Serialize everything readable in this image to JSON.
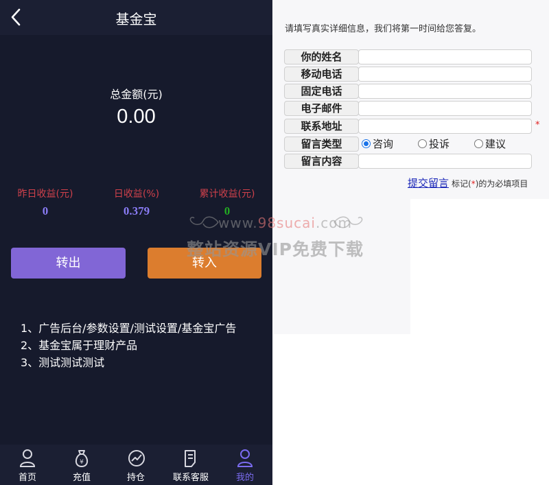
{
  "header": {
    "title": "基金宝"
  },
  "summary": {
    "total_label": "总金额(元)",
    "total_value": "0.00"
  },
  "stats": [
    {
      "label": "昨日收益(元)",
      "value": "0",
      "value_color": "#8a7cf5"
    },
    {
      "label": "日收益(%)",
      "value": "0.379",
      "value_color": "#8a7cf5"
    },
    {
      "label": "累计收益(元)",
      "value": "0",
      "value_color": "#22aa22"
    }
  ],
  "actions": {
    "transfer_out": "转出",
    "transfer_in": "转入"
  },
  "notes": [
    "1、广告后台/参数设置/测试设置/基金宝广告",
    "2、基金宝属于理财产品",
    "3、测试测试测试"
  ],
  "tabs": [
    {
      "label": "首页",
      "icon": "user-icon"
    },
    {
      "label": "充值",
      "icon": "money-bag-icon"
    },
    {
      "label": "持仓",
      "icon": "chart-icon"
    },
    {
      "label": "联系客服",
      "icon": "document-icon"
    },
    {
      "label": "我的",
      "icon": "user-icon",
      "active": true
    }
  ],
  "form": {
    "intro": "请填写真实详细信息，我们将第一时间给您答复。",
    "fields": [
      {
        "label": "你的姓名",
        "value": ""
      },
      {
        "label": "移动电话",
        "value": ""
      },
      {
        "label": "固定电话",
        "value": ""
      },
      {
        "label": "电子邮件",
        "value": ""
      },
      {
        "label": "联系地址",
        "value": ""
      }
    ],
    "required_mark": "*",
    "type_label": "留言类型",
    "type_options": [
      "咨询",
      "投诉",
      "建议"
    ],
    "type_selected": "咨询",
    "content_label": "留言内容",
    "content_value": "",
    "submit_label": "提交留言",
    "hint_prefix": "标记(",
    "hint_star": "*",
    "hint_suffix": ")的为必填项目"
  },
  "watermark": {
    "url_prefix": "www.",
    "url_highlight": "98sucai",
    "url_suffix": ".com",
    "text": "整站资源VIP免费下载"
  },
  "colors": {
    "bg": "#161a2c",
    "bar": "#1b1f33",
    "out_button": "#8166d6",
    "in_button": "#dc7d2e",
    "stat_label": "#d0414b",
    "active_tab": "#7b6cf0",
    "link": "#1a26b8"
  }
}
